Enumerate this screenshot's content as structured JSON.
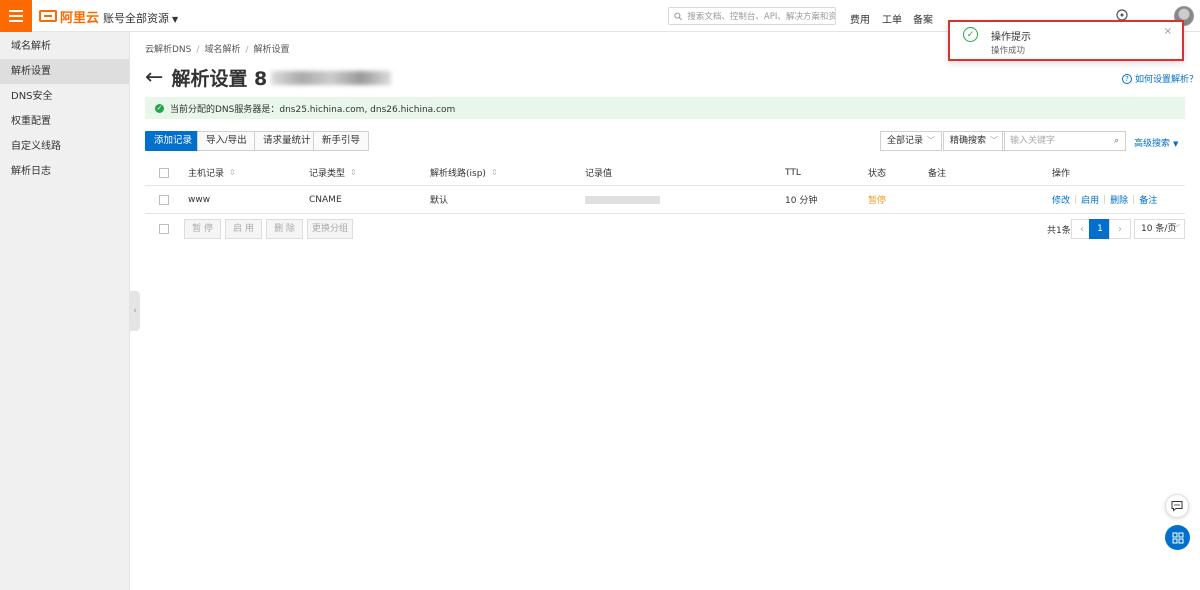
{
  "topbar": {
    "logo_text": "阿里云",
    "account_scope": "账号全部资源",
    "search_placeholder": "搜索文档、控制台、API、解决方案和资源",
    "nav": [
      "费用",
      "工单",
      "备案"
    ],
    "brand_color": "#ff6a00"
  },
  "sidebar": {
    "items": [
      {
        "label": "域名解析",
        "active": false
      },
      {
        "label": "解析设置",
        "active": true
      },
      {
        "label": "DNS安全",
        "active": false
      },
      {
        "label": "权重配置",
        "active": false
      },
      {
        "label": "自定义线路",
        "active": false
      },
      {
        "label": "解析日志",
        "active": false
      }
    ]
  },
  "breadcrumb": [
    "云解析DNS",
    "域名解析",
    "解析设置"
  ],
  "page": {
    "title": "解析设置 8",
    "help_link": "如何设置解析？"
  },
  "notice": {
    "text": "当前分配的DNS服务器是：dns25.hichina.com, dns26.hichina.com"
  },
  "toolbar": {
    "add_record": "添加记录",
    "import_export": "导入/导出",
    "request_stats": "请求量统计",
    "beginner_guide": "新手引导",
    "filter_select": "全部记录",
    "search_mode": "精确搜索",
    "keyword_placeholder": "输入关键字",
    "advanced_search": "高级搜索"
  },
  "table": {
    "columns": [
      "主机记录",
      "记录类型",
      "解析线路(isp)",
      "记录值",
      "TTL",
      "状态",
      "备注",
      "操作"
    ],
    "rows": [
      {
        "host": "www",
        "type": "CNAME",
        "line": "默认",
        "value": "",
        "ttl": "10 分钟",
        "status": "暂停",
        "remark": "",
        "actions": [
          "修改",
          "启用",
          "删除",
          "备注"
        ]
      }
    ]
  },
  "bulk_actions": [
    "暂 停",
    "启 用",
    "删 除",
    "更换分组"
  ],
  "pagination": {
    "total": "共1条",
    "current_page": "1",
    "page_size": "10 条/页"
  },
  "toast": {
    "title": "操作提示",
    "message": "操作成功"
  },
  "colors": {
    "primary": "#0070cc",
    "success": "#27a54a",
    "paused": "#f59a23",
    "highlight_border": "#d9312b"
  }
}
